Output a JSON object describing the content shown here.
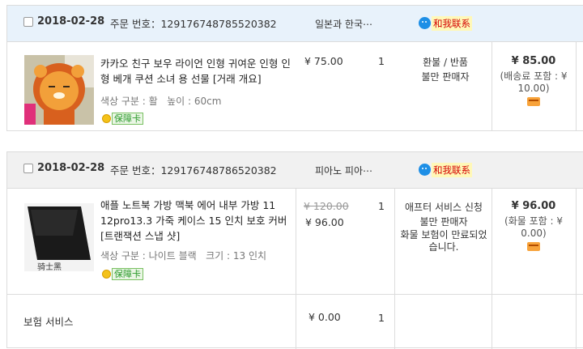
{
  "orders": [
    {
      "date": "2018-02-28",
      "order_no_label": "주문 번호：",
      "order_no": "1291767487855203​82",
      "shop": "일본과 한국⋯",
      "contact_label": "和我联系",
      "item": {
        "title": "카카오 친구 보우 라이언 인형 귀여운 인형 인형 베개 쿠션 소녀 용 선물 [거래 개요]",
        "sku_label": "색상 구분 : 활",
        "sku_size": "높이 : 60cm",
        "guarantee": "保障卡",
        "price": "¥ 75.00",
        "qty": "1",
        "status_line1": "환불 / 반품",
        "status_line2": "불만 판매자"
      },
      "total": "¥ 85.00",
      "total_note": "(배송료 포함 : ¥ 10.00)"
    },
    {
      "date": "2018-02-28",
      "order_no_label": "주문 번호：",
      "order_no": "129176748786520382",
      "shop": "피아노 피아⋯",
      "contact_label": "和我联系",
      "item": {
        "title": "애플 노트북 가방 맥북 에어 내부 가방 11 12pro13.3 가죽 케이스 15 인치 보호 커버 [트랜잭션 스냅 샷]",
        "sku_label": "색상 구분 : 나이트 블랙",
        "sku_size": "크기 : 13 인치",
        "thumb_caption": "骑士黑",
        "guarantee": "保障卡",
        "orig_price": "¥ 120.00",
        "price": "¥ 96.00",
        "qty": "1",
        "status_line1": "애프터 서비스 신청",
        "status_line2": "불만 판매자",
        "status_line3": "화물 보험이 만료되었습니다."
      },
      "insurance": {
        "label": "보험 서비스",
        "price": "¥ 0.00",
        "qty": "1"
      },
      "total": "¥ 96.00",
      "total_note": "(화물 포함 : ¥ 0.00)"
    }
  ],
  "colors": {
    "header_blue": "#e8f2fb",
    "header_gray": "#f1f1f1",
    "contact_red": "#d40000"
  }
}
